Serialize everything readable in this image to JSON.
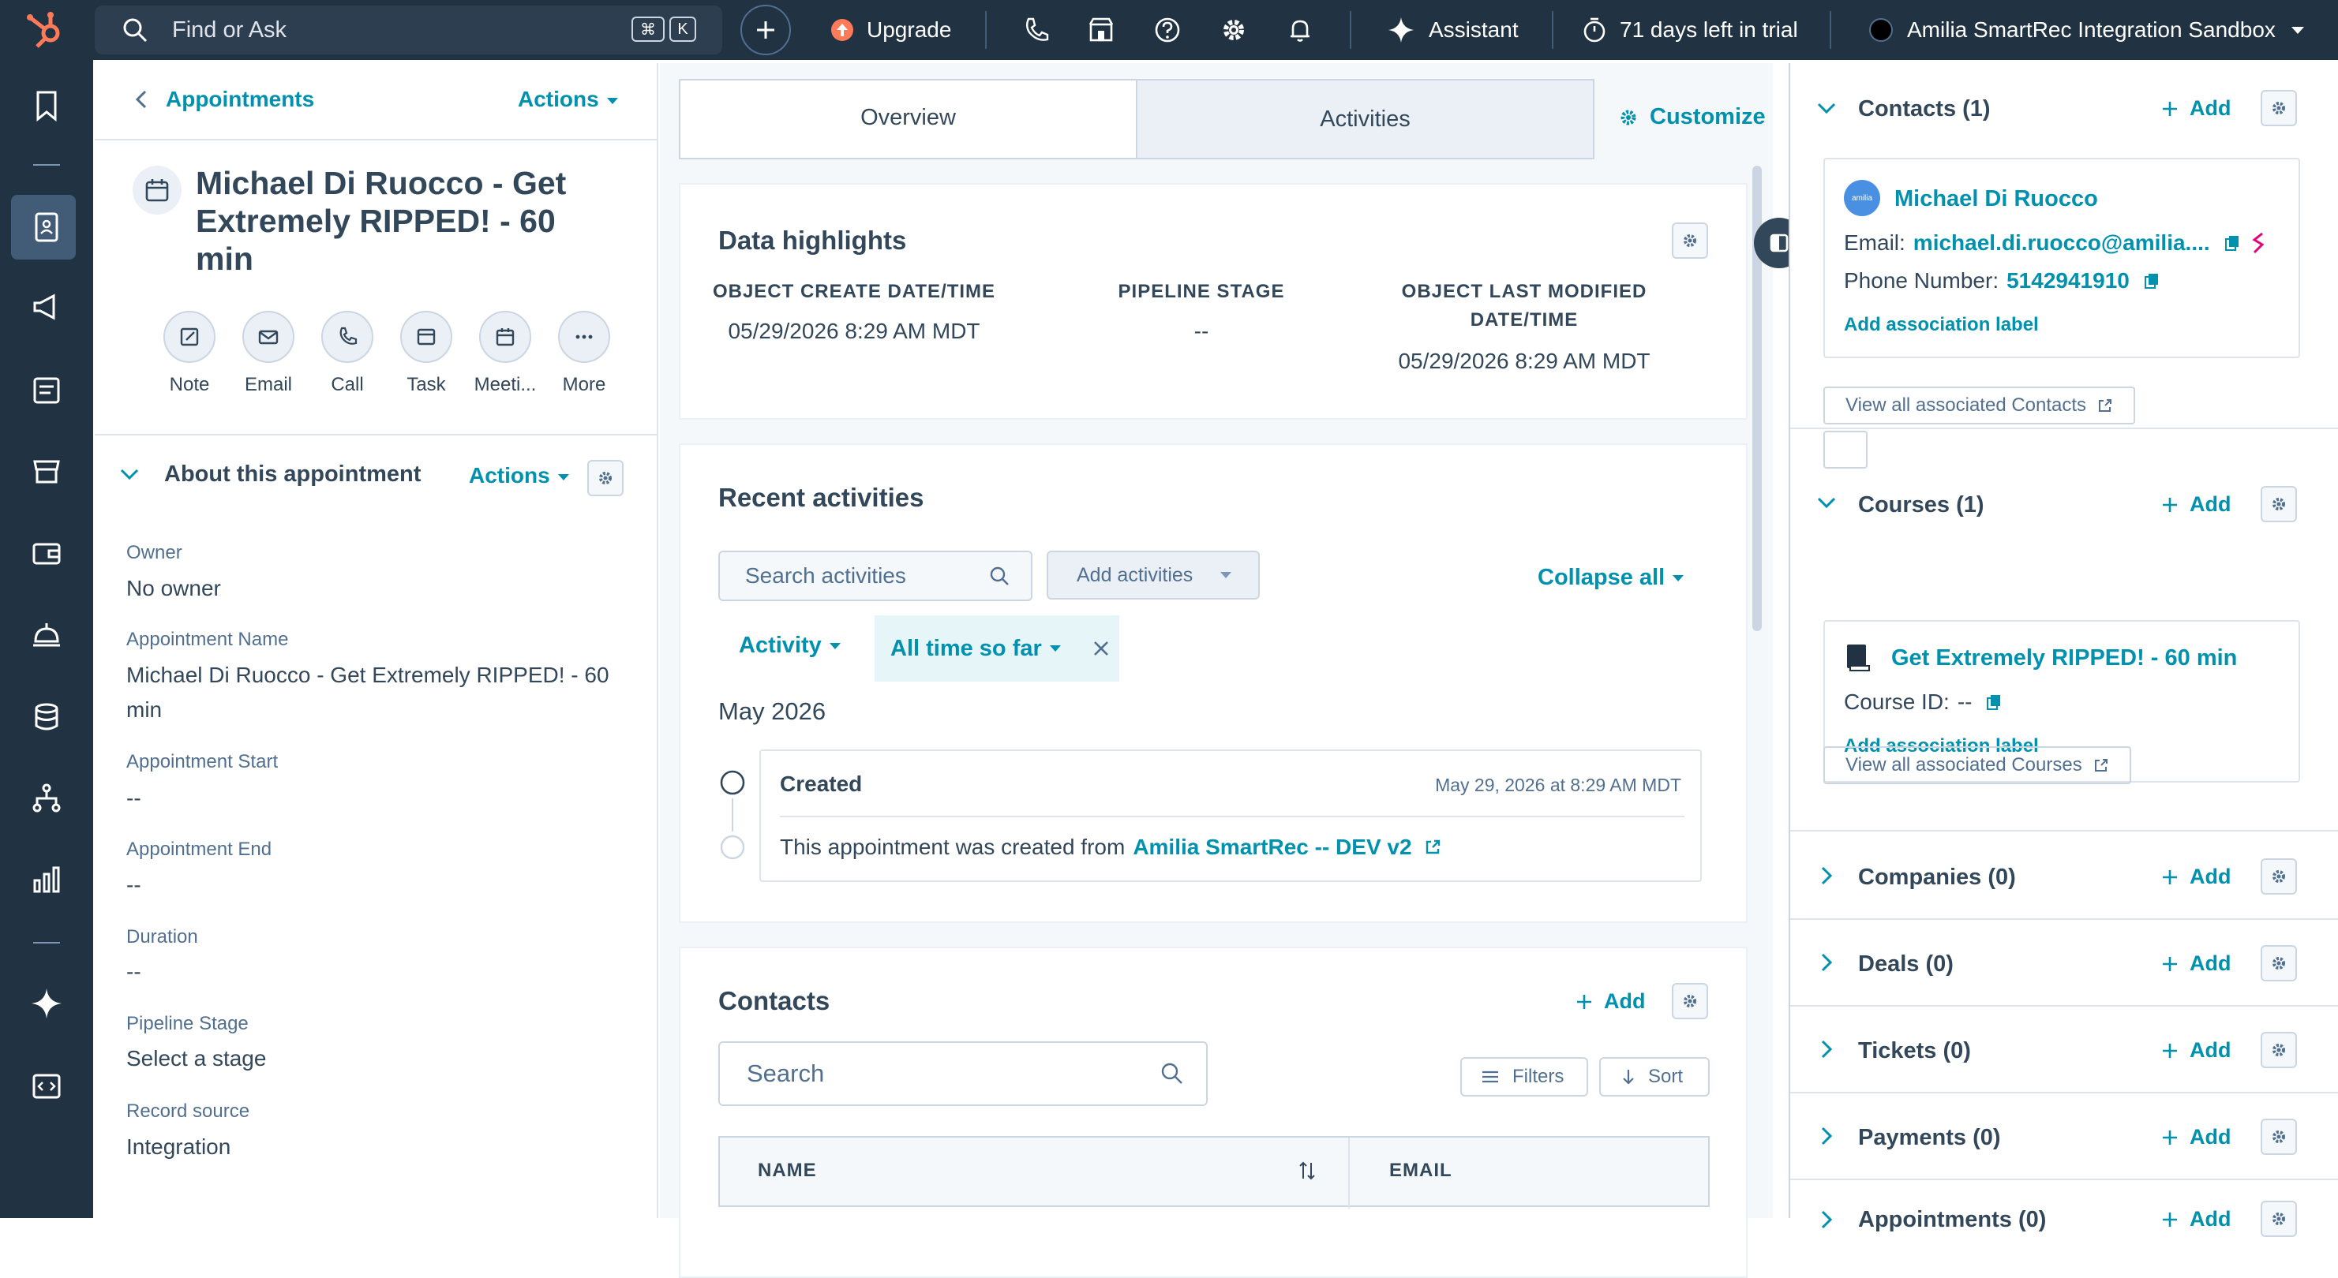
{
  "topbar": {
    "search_placeholder": "Find or Ask",
    "kbd1": "⌘",
    "kbd2": "K",
    "upgrade": "Upgrade",
    "assistant": "Assistant",
    "trial": "71 days left in trial",
    "account": "Amilia SmartRec Integration Sandbox"
  },
  "left": {
    "breadcrumb": "Appointments",
    "actions": "Actions",
    "title": "Michael Di Ruocco - Get Extremely RIPPED! - 60 min",
    "quick_actions": [
      "Note",
      "Email",
      "Call",
      "Task",
      "Meeti...",
      "More"
    ],
    "about_title": "About this appointment",
    "about_actions": "Actions",
    "props": [
      {
        "label": "Owner",
        "value": "No owner"
      },
      {
        "label": "Appointment Name",
        "value": "Michael Di Ruocco - Get Extremely RIPPED! - 60 min"
      },
      {
        "label": "Appointment Start",
        "value": "--"
      },
      {
        "label": "Appointment End",
        "value": "--"
      },
      {
        "label": "Duration",
        "value": "--"
      },
      {
        "label": "Pipeline Stage",
        "value": "Select a stage"
      },
      {
        "label": "Record source",
        "value": "Integration"
      }
    ]
  },
  "center": {
    "tabs": [
      "Overview",
      "Activities"
    ],
    "customize": "Customize",
    "highlights": {
      "title": "Data highlights",
      "items": [
        {
          "label": "OBJECT CREATE DATE/TIME",
          "value": "05/29/2026 8:29 AM MDT"
        },
        {
          "label": "PIPELINE STAGE",
          "value": "--"
        },
        {
          "label": "OBJECT LAST MODIFIED DATE/TIME",
          "value": "05/29/2026 8:29 AM MDT"
        }
      ]
    },
    "recent": {
      "title": "Recent activities",
      "search_placeholder": "Search activities",
      "add_activities": "Add activities",
      "collapse_all": "Collapse all",
      "filter_activity": "Activity",
      "filter_time": "All time so far",
      "month": "May 2026",
      "event": {
        "title": "Created",
        "time": "May 29, 2026 at 8:29 AM MDT",
        "text": "This appointment was created from",
        "link": "Amilia SmartRec -- DEV v2"
      }
    },
    "contacts": {
      "title": "Contacts",
      "add": "Add",
      "search_placeholder": "Search",
      "filters": "Filters",
      "sort": "Sort",
      "col_name": "NAME",
      "col_email": "EMAIL"
    }
  },
  "right": {
    "contacts": {
      "title": "Contacts (1)",
      "add": "Add",
      "name": "Michael Di Ruocco",
      "email_label": "Email:",
      "email": "michael.di.ruocco@amilia....",
      "phone_label": "Phone Number:",
      "phone": "5142941910",
      "assoc": "Add association label",
      "view_all": "View all associated Contacts"
    },
    "courses": {
      "title": "Courses (1)",
      "add": "Add",
      "name": "Get Extremely RIPPED! - 60 min",
      "id_label": "Course ID:",
      "id": "--",
      "assoc": "Add association label",
      "view_all": "View all associated Courses"
    },
    "collapsed": [
      {
        "title": "Companies (0)",
        "add": "Add"
      },
      {
        "title": "Deals (0)",
        "add": "Add"
      },
      {
        "title": "Tickets (0)",
        "add": "Add"
      },
      {
        "title": "Payments (0)",
        "add": "Add"
      },
      {
        "title": "Appointments (0)",
        "add": "Add"
      }
    ]
  },
  "colors": {
    "nav": "#213343",
    "link": "#0091ae",
    "text": "#33475b",
    "brand": "#ff7a59"
  }
}
